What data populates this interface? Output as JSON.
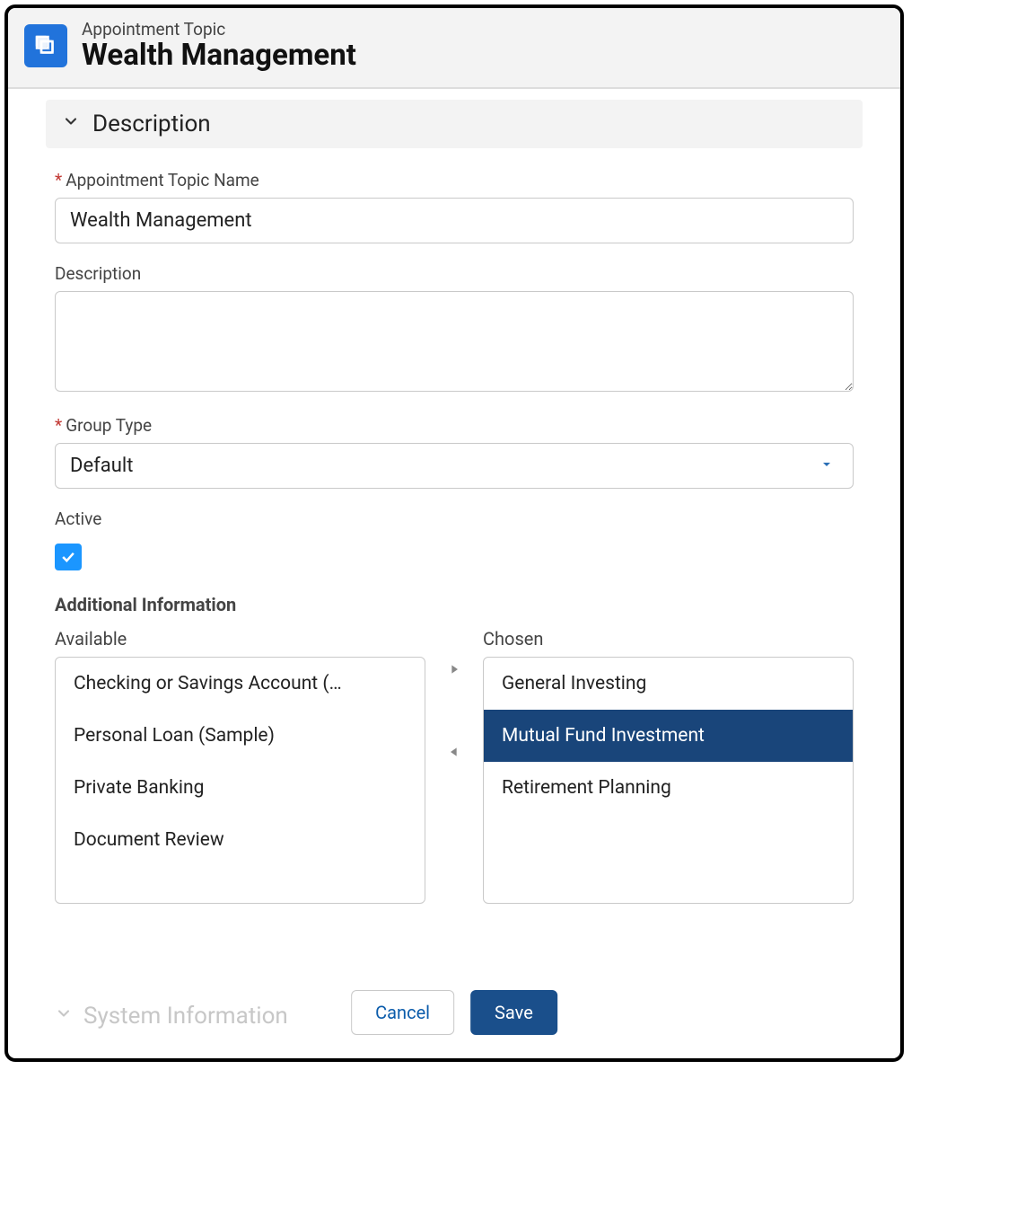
{
  "header": {
    "eyebrow": "Appointment Topic",
    "title": "Wealth Management"
  },
  "sections": {
    "description": {
      "title": "Description"
    },
    "system_info": {
      "title": "System Information"
    }
  },
  "fields": {
    "name": {
      "label": "Appointment Topic Name",
      "required": true,
      "value": "Wealth Management"
    },
    "description": {
      "label": "Description",
      "required": false,
      "value": ""
    },
    "group_type": {
      "label": "Group Type",
      "required": true,
      "selected": "Default"
    },
    "active": {
      "label": "Active",
      "checked": true
    }
  },
  "additional_info": {
    "heading": "Additional Information",
    "available_label": "Available",
    "chosen_label": "Chosen",
    "available": [
      "Checking or Savings Account (…",
      "Personal Loan (Sample)",
      "Private Banking",
      "Document Review"
    ],
    "chosen": [
      {
        "label": "General Investing",
        "selected": false
      },
      {
        "label": "Mutual Fund Investment",
        "selected": true
      },
      {
        "label": "Retirement Planning",
        "selected": false
      }
    ]
  },
  "actions": {
    "cancel": "Cancel",
    "save": "Save"
  }
}
